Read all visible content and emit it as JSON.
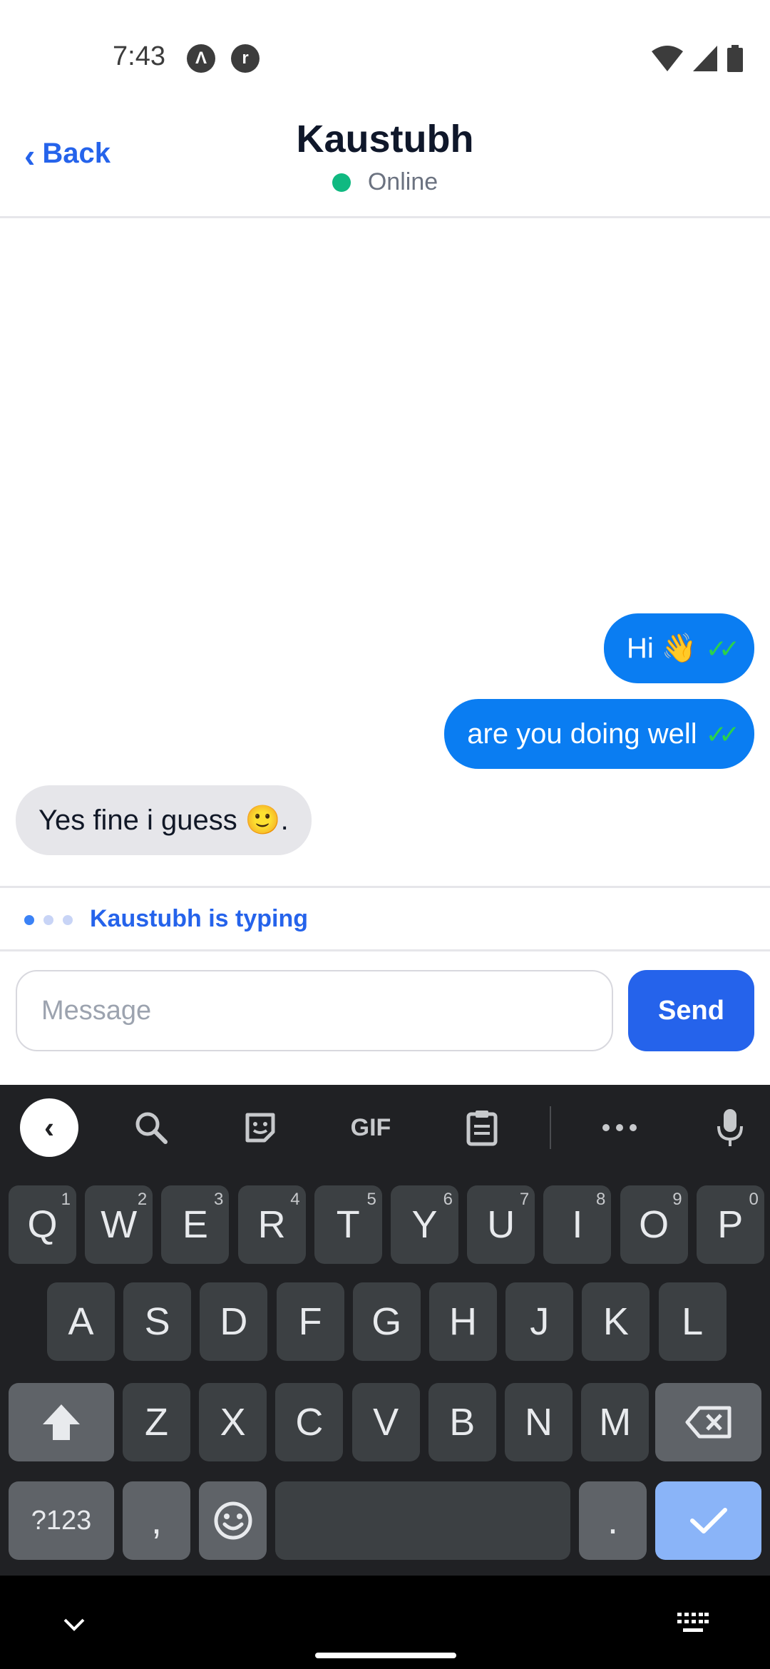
{
  "status_bar": {
    "time": "7:43",
    "left_icons": [
      "a-icon",
      "r-icon"
    ],
    "right_icons": [
      "wifi-icon",
      "signal-icon",
      "battery-icon"
    ]
  },
  "header": {
    "back_label": "Back",
    "contact_name": "Kaustubh",
    "presence": "Online",
    "presence_color": "#10b981"
  },
  "messages": [
    {
      "direction": "outgoing",
      "text": "Hi 👋",
      "status": "read"
    },
    {
      "direction": "outgoing",
      "text": "are you doing well",
      "status": "read"
    },
    {
      "direction": "incoming",
      "text": "Yes fine i guess 🙂."
    }
  ],
  "typing_indicator": "Kaustubh is typing",
  "composer": {
    "placeholder": "Message",
    "value": "",
    "send_label": "Send"
  },
  "keyboard": {
    "toolbar": [
      "collapse-icon",
      "search-icon",
      "sticker-icon",
      "GIF",
      "clipboard-icon",
      "more-icon",
      "mic-icon"
    ],
    "row1": [
      "Q",
      "W",
      "E",
      "R",
      "T",
      "Y",
      "U",
      "I",
      "O",
      "P"
    ],
    "row1_hints": [
      "1",
      "2",
      "3",
      "4",
      "5",
      "6",
      "7",
      "8",
      "9",
      "0"
    ],
    "row2": [
      "A",
      "S",
      "D",
      "F",
      "G",
      "H",
      "J",
      "K",
      "L"
    ],
    "row3": [
      "Z",
      "X",
      "C",
      "V",
      "B",
      "N",
      "M"
    ],
    "symbols_label": "?123",
    "comma": ",",
    "period": "."
  },
  "colors": {
    "accent": "#2563eb",
    "outgoing_bubble": "#0a7df2",
    "incoming_bubble": "#e6e6ea",
    "read_tick": "#2bd14b"
  }
}
